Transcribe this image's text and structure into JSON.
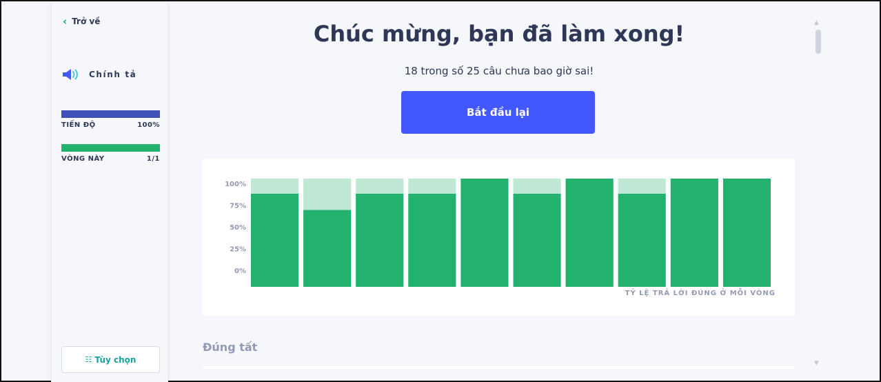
{
  "sidebar": {
    "back_label": "Trở về",
    "mode_label": "Chính tả",
    "mode_icon": "speaker-icon",
    "progress": {
      "label": "TIẾN ĐỘ",
      "value_text": "100%",
      "value": 1.0,
      "color": "#3f51b5"
    },
    "round": {
      "label": "VÒNG NÀY",
      "value_text": "1/1",
      "value": 1.0,
      "color": "#23b26d"
    },
    "options_label": "Tùy chọn",
    "options_icon": "sliders-icon"
  },
  "main": {
    "title": "Chúc mừng, bạn đã làm xong!",
    "subtitle": "18 trong số 25 câu chưa bao giờ sai!",
    "restart_label": "Bắt đầu lại",
    "section_heading": "Đúng tất"
  },
  "colors": {
    "accent": "#4257ff",
    "correct": "#23b26d",
    "remaining": "#bfe8d5",
    "text": "#2e3856"
  },
  "chart_data": {
    "type": "bar",
    "stacked": true,
    "categories": [
      "",
      "",
      "",
      "",
      "",
      "",
      "",
      "",
      "",
      ""
    ],
    "series": [
      {
        "values": [
          86,
          71,
          86,
          86,
          100,
          86,
          100,
          86,
          100,
          100
        ]
      }
    ],
    "y_ticks": [
      "100%",
      "75%",
      "50%",
      "25%",
      "0%"
    ],
    "xlabel": "TỶ LỆ TRẢ LỜI ĐÚNG Ở MỖI VÒNG",
    "ylim": [
      0,
      100
    ],
    "grid": false
  }
}
